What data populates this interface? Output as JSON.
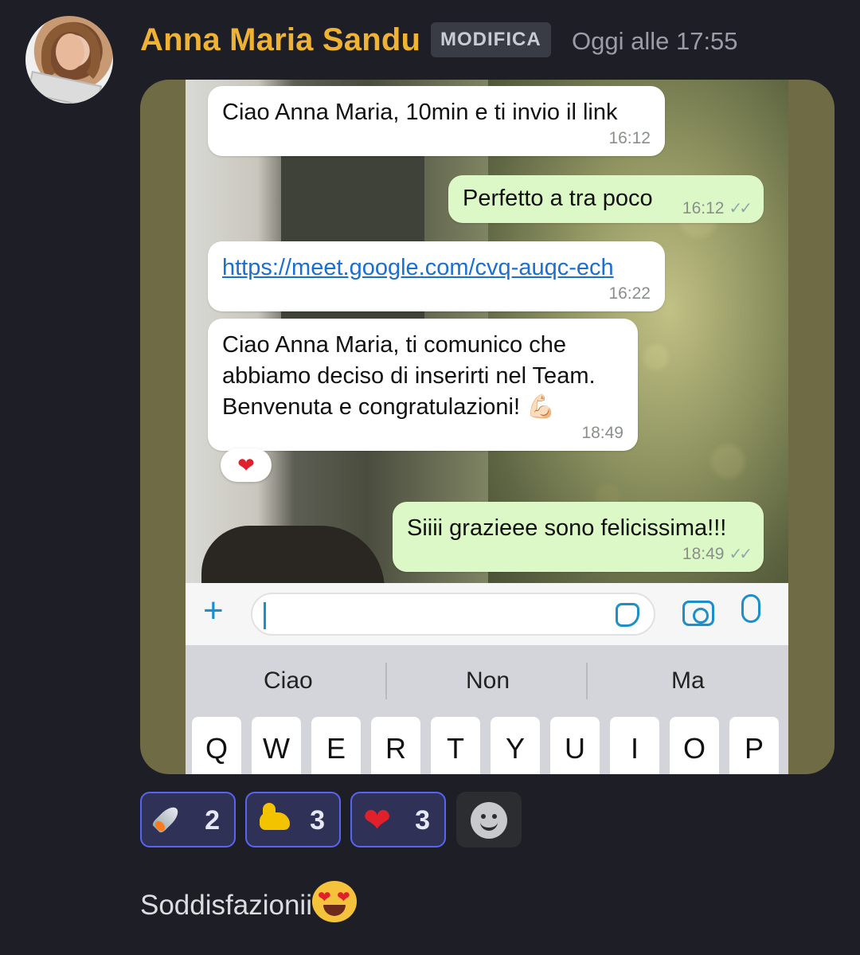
{
  "message": {
    "author": "Anna Maria Sandu",
    "role_badge": "MODIFICA",
    "timestamp": "Oggi alle 17:55",
    "avatar_icon": "user-avatar",
    "author_color": "#f0b232"
  },
  "attachment": {
    "chat": [
      {
        "direction": "in",
        "text": "Ciao Anna Maria, 10min e ti invio il link",
        "time": "16:12"
      },
      {
        "direction": "out",
        "text": "Perfetto a tra poco",
        "time": "16:12",
        "ticks": "✓✓"
      },
      {
        "direction": "in",
        "text": "https://meet.google.com/cvq-auqc-ech",
        "time": "16:22",
        "is_link": true
      },
      {
        "direction": "in",
        "line1": "Ciao Anna Maria, ti comunico che",
        "line2": "abbiamo deciso di inserirti nel Team.",
        "line3": "Benvenuta e congratulazioni! 💪🏻",
        "time": "18:49"
      },
      {
        "direction": "out",
        "text": "Siiii grazieee sono felicissima!!!",
        "time": "18:49",
        "ticks": "✓✓"
      }
    ],
    "mini_reaction": "❤",
    "keyboard": {
      "suggestions": [
        "Ciao",
        "Non",
        "Ma"
      ],
      "keys": [
        "Q",
        "W",
        "E",
        "R",
        "T",
        "Y",
        "U",
        "I",
        "O",
        "P"
      ]
    },
    "composer_icons": [
      "plus-icon",
      "sticker-icon",
      "camera-icon",
      "microphone-icon"
    ],
    "accent_color": "#1a8fc9"
  },
  "reactions": [
    {
      "emoji": "rocket-icon",
      "count": "2"
    },
    {
      "emoji": "flexed-biceps-icon",
      "count": "3"
    },
    {
      "emoji": "heart-icon",
      "count": "3"
    }
  ],
  "add_reaction_icon": "smiley-icon",
  "followup_message": {
    "text": "Soddisfazionii",
    "emoji": "heart-eyes-icon"
  }
}
